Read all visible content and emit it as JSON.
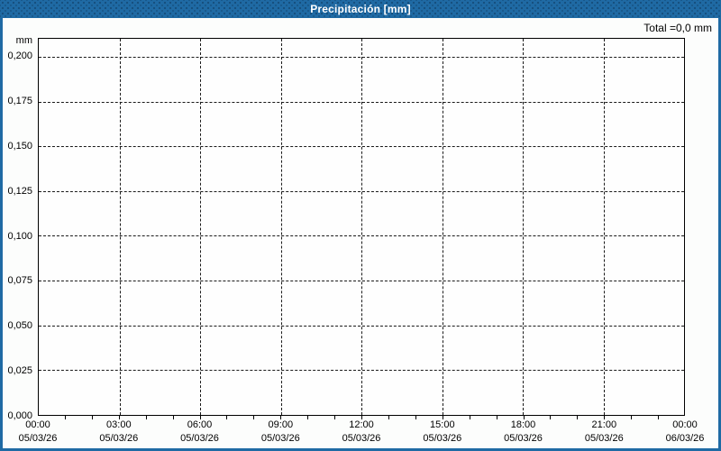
{
  "window": {
    "title": "Precipitación [mm]"
  },
  "summary": {
    "total_label": "Total =0,0 mm"
  },
  "colors": {
    "frame_blue": "#1f6aa4",
    "grid": "#1a1a1a",
    "text": "#000000",
    "title_text": "#ffffff",
    "background": "#fcfdfc"
  },
  "chart_data": {
    "type": "bar",
    "title": "Precipitación [mm]",
    "ylabel": "mm",
    "xlabel": "",
    "total": "0,0 mm",
    "grid": true,
    "ylim": [
      0,
      0.21
    ],
    "yticks": [
      {
        "value": 0.2,
        "label": "0,200"
      },
      {
        "value": 0.175,
        "label": "0,175"
      },
      {
        "value": 0.15,
        "label": "0,150"
      },
      {
        "value": 0.125,
        "label": "0,125"
      },
      {
        "value": 0.1,
        "label": "0,100"
      },
      {
        "value": 0.075,
        "label": "0,075"
      },
      {
        "value": 0.05,
        "label": "0,050"
      },
      {
        "value": 0.025,
        "label": "0,025"
      },
      {
        "value": 0.0,
        "label": "0,000"
      }
    ],
    "x_total_hours": 24,
    "x_minor_step_hours": 1,
    "xticks": [
      {
        "hour": 0,
        "time": "00:00",
        "date": "05/03/26"
      },
      {
        "hour": 3,
        "time": "03:00",
        "date": "05/03/26"
      },
      {
        "hour": 6,
        "time": "06:00",
        "date": "05/03/26"
      },
      {
        "hour": 9,
        "time": "09:00",
        "date": "05/03/26"
      },
      {
        "hour": 12,
        "time": "12:00",
        "date": "05/03/26"
      },
      {
        "hour": 15,
        "time": "15:00",
        "date": "05/03/26"
      },
      {
        "hour": 18,
        "time": "18:00",
        "date": "05/03/26"
      },
      {
        "hour": 21,
        "time": "21:00",
        "date": "05/03/26"
      },
      {
        "hour": 24,
        "time": "00:00",
        "date": "06/03/26"
      }
    ],
    "series": [
      {
        "name": "Precipitación",
        "values": []
      }
    ]
  }
}
